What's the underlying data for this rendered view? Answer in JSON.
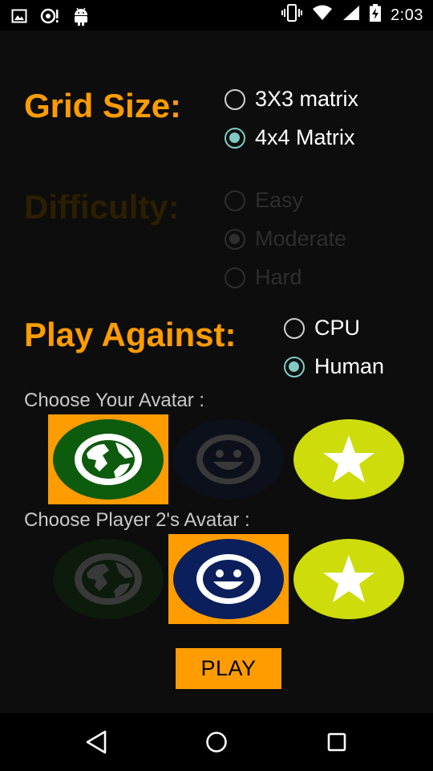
{
  "status_bar": {
    "time": "2:03",
    "left_icons": [
      "image-icon",
      "notification-icon",
      "android-icon"
    ],
    "right_icons": [
      "vibrate-icon",
      "wifi-icon",
      "signal-icon",
      "battery-icon"
    ]
  },
  "grid_size": {
    "heading": "Grid Size:",
    "options": [
      {
        "label": "3X3 matrix",
        "checked": false
      },
      {
        "label": "4x4 Matrix",
        "checked": true
      }
    ]
  },
  "difficulty": {
    "heading": "Difficulty:",
    "enabled": false,
    "options": [
      {
        "label": "Easy",
        "checked": false
      },
      {
        "label": "Moderate",
        "checked": true
      },
      {
        "label": "Hard",
        "checked": false
      }
    ]
  },
  "play_against": {
    "heading": "Play Against:",
    "options": [
      {
        "label": "CPU",
        "checked": false
      },
      {
        "label": "Human",
        "checked": true
      }
    ]
  },
  "your_avatar": {
    "label": "Choose Your Avatar :",
    "avatars": [
      {
        "icon": "globe-icon",
        "color": "#0d5b0d",
        "selected": true,
        "enabled": true
      },
      {
        "icon": "smiley-icon",
        "color": "#0b1f5c",
        "selected": false,
        "enabled": false
      },
      {
        "icon": "star-icon",
        "color": "#cddc0a",
        "selected": false,
        "enabled": true
      }
    ]
  },
  "player2_avatar": {
    "label": "Choose Player 2's Avatar :",
    "avatars": [
      {
        "icon": "globe-icon",
        "color": "#0d5b0d",
        "selected": false,
        "enabled": false
      },
      {
        "icon": "smiley-icon",
        "color": "#0b1f5c",
        "selected": true,
        "enabled": true
      },
      {
        "icon": "star-icon",
        "color": "#cddc0a",
        "selected": false,
        "enabled": true
      }
    ]
  },
  "play_button": {
    "label": "PLAY"
  },
  "colors": {
    "accent": "#ff9c00",
    "radio_checked": "#80cbc4",
    "background": "#0d0d0d"
  },
  "nav_bar": {
    "buttons": [
      "back-icon",
      "home-icon",
      "recents-icon"
    ]
  }
}
